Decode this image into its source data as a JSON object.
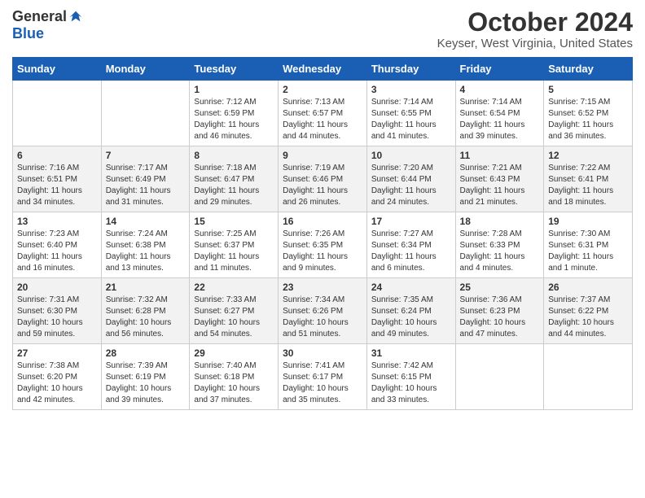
{
  "header": {
    "logo_general": "General",
    "logo_blue": "Blue",
    "title": "October 2024",
    "subtitle": "Keyser, West Virginia, United States"
  },
  "weekdays": [
    "Sunday",
    "Monday",
    "Tuesday",
    "Wednesday",
    "Thursday",
    "Friday",
    "Saturday"
  ],
  "weeks": [
    [
      {
        "day": "",
        "info": ""
      },
      {
        "day": "",
        "info": ""
      },
      {
        "day": "1",
        "info": "Sunrise: 7:12 AM\nSunset: 6:59 PM\nDaylight: 11 hours and 46 minutes."
      },
      {
        "day": "2",
        "info": "Sunrise: 7:13 AM\nSunset: 6:57 PM\nDaylight: 11 hours and 44 minutes."
      },
      {
        "day": "3",
        "info": "Sunrise: 7:14 AM\nSunset: 6:55 PM\nDaylight: 11 hours and 41 minutes."
      },
      {
        "day": "4",
        "info": "Sunrise: 7:14 AM\nSunset: 6:54 PM\nDaylight: 11 hours and 39 minutes."
      },
      {
        "day": "5",
        "info": "Sunrise: 7:15 AM\nSunset: 6:52 PM\nDaylight: 11 hours and 36 minutes."
      }
    ],
    [
      {
        "day": "6",
        "info": "Sunrise: 7:16 AM\nSunset: 6:51 PM\nDaylight: 11 hours and 34 minutes."
      },
      {
        "day": "7",
        "info": "Sunrise: 7:17 AM\nSunset: 6:49 PM\nDaylight: 11 hours and 31 minutes."
      },
      {
        "day": "8",
        "info": "Sunrise: 7:18 AM\nSunset: 6:47 PM\nDaylight: 11 hours and 29 minutes."
      },
      {
        "day": "9",
        "info": "Sunrise: 7:19 AM\nSunset: 6:46 PM\nDaylight: 11 hours and 26 minutes."
      },
      {
        "day": "10",
        "info": "Sunrise: 7:20 AM\nSunset: 6:44 PM\nDaylight: 11 hours and 24 minutes."
      },
      {
        "day": "11",
        "info": "Sunrise: 7:21 AM\nSunset: 6:43 PM\nDaylight: 11 hours and 21 minutes."
      },
      {
        "day": "12",
        "info": "Sunrise: 7:22 AM\nSunset: 6:41 PM\nDaylight: 11 hours and 18 minutes."
      }
    ],
    [
      {
        "day": "13",
        "info": "Sunrise: 7:23 AM\nSunset: 6:40 PM\nDaylight: 11 hours and 16 minutes."
      },
      {
        "day": "14",
        "info": "Sunrise: 7:24 AM\nSunset: 6:38 PM\nDaylight: 11 hours and 13 minutes."
      },
      {
        "day": "15",
        "info": "Sunrise: 7:25 AM\nSunset: 6:37 PM\nDaylight: 11 hours and 11 minutes."
      },
      {
        "day": "16",
        "info": "Sunrise: 7:26 AM\nSunset: 6:35 PM\nDaylight: 11 hours and 9 minutes."
      },
      {
        "day": "17",
        "info": "Sunrise: 7:27 AM\nSunset: 6:34 PM\nDaylight: 11 hours and 6 minutes."
      },
      {
        "day": "18",
        "info": "Sunrise: 7:28 AM\nSunset: 6:33 PM\nDaylight: 11 hours and 4 minutes."
      },
      {
        "day": "19",
        "info": "Sunrise: 7:30 AM\nSunset: 6:31 PM\nDaylight: 11 hours and 1 minute."
      }
    ],
    [
      {
        "day": "20",
        "info": "Sunrise: 7:31 AM\nSunset: 6:30 PM\nDaylight: 10 hours and 59 minutes."
      },
      {
        "day": "21",
        "info": "Sunrise: 7:32 AM\nSunset: 6:28 PM\nDaylight: 10 hours and 56 minutes."
      },
      {
        "day": "22",
        "info": "Sunrise: 7:33 AM\nSunset: 6:27 PM\nDaylight: 10 hours and 54 minutes."
      },
      {
        "day": "23",
        "info": "Sunrise: 7:34 AM\nSunset: 6:26 PM\nDaylight: 10 hours and 51 minutes."
      },
      {
        "day": "24",
        "info": "Sunrise: 7:35 AM\nSunset: 6:24 PM\nDaylight: 10 hours and 49 minutes."
      },
      {
        "day": "25",
        "info": "Sunrise: 7:36 AM\nSunset: 6:23 PM\nDaylight: 10 hours and 47 minutes."
      },
      {
        "day": "26",
        "info": "Sunrise: 7:37 AM\nSunset: 6:22 PM\nDaylight: 10 hours and 44 minutes."
      }
    ],
    [
      {
        "day": "27",
        "info": "Sunrise: 7:38 AM\nSunset: 6:20 PM\nDaylight: 10 hours and 42 minutes."
      },
      {
        "day": "28",
        "info": "Sunrise: 7:39 AM\nSunset: 6:19 PM\nDaylight: 10 hours and 39 minutes."
      },
      {
        "day": "29",
        "info": "Sunrise: 7:40 AM\nSunset: 6:18 PM\nDaylight: 10 hours and 37 minutes."
      },
      {
        "day": "30",
        "info": "Sunrise: 7:41 AM\nSunset: 6:17 PM\nDaylight: 10 hours and 35 minutes."
      },
      {
        "day": "31",
        "info": "Sunrise: 7:42 AM\nSunset: 6:15 PM\nDaylight: 10 hours and 33 minutes."
      },
      {
        "day": "",
        "info": ""
      },
      {
        "day": "",
        "info": ""
      }
    ]
  ]
}
